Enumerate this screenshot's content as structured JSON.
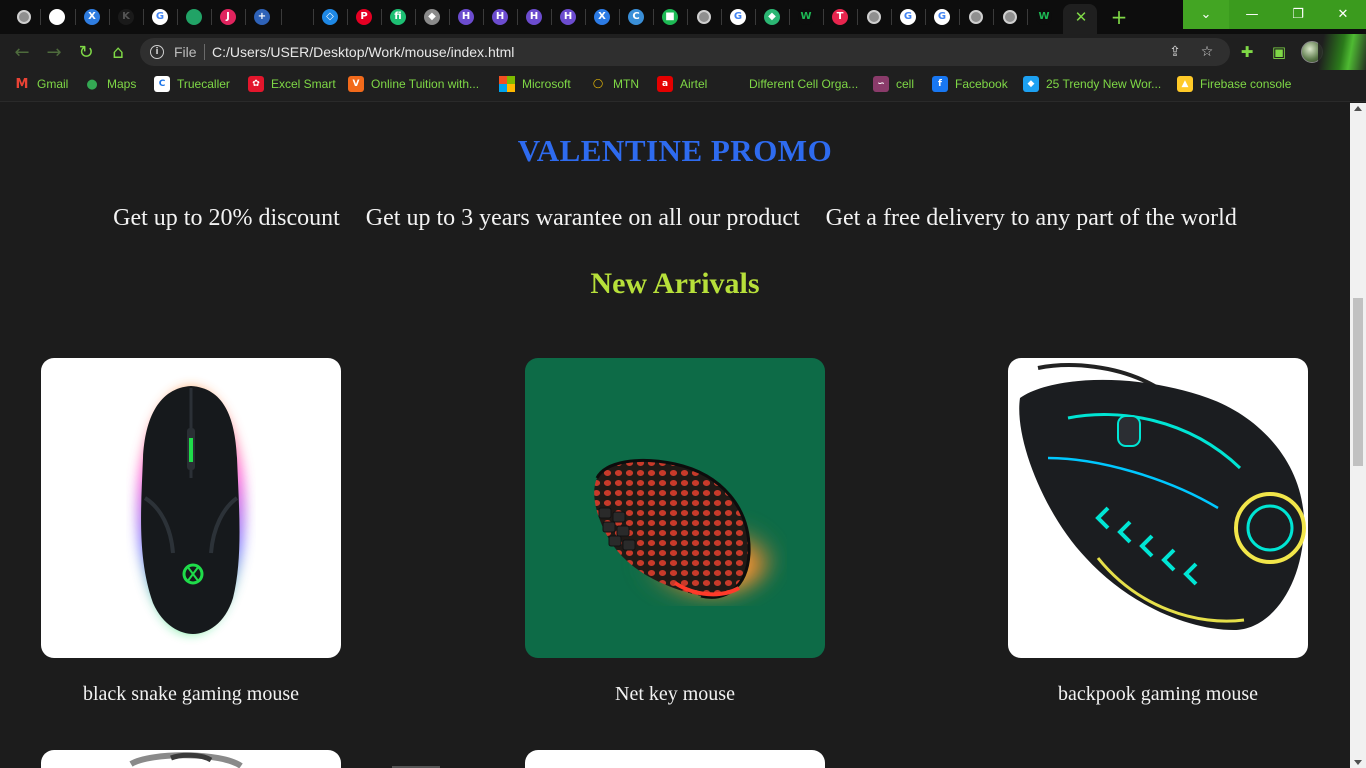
{
  "browser": {
    "tabs": [
      {
        "icon": "globe-icon",
        "color": "#9a9a9a",
        "glyph": ""
      },
      {
        "icon": "github-icon",
        "color": "#ffffff",
        "glyph": ""
      },
      {
        "icon": "x-brand-icon",
        "color": "#2f7de1",
        "glyph": "X"
      },
      {
        "icon": "k-letter-icon",
        "color": "#1a1a1a",
        "glyph": "K"
      },
      {
        "icon": "google-icon",
        "color": "#ffffff",
        "glyph": "G"
      },
      {
        "icon": "sheet-icon",
        "color": "#21a366",
        "glyph": ""
      },
      {
        "icon": "j-letter-icon",
        "color": "#e0245e",
        "glyph": "J"
      },
      {
        "icon": "cross-icon",
        "color": "#2e62b8",
        "glyph": "+"
      },
      {
        "icon": "blank-icon",
        "color": "#0d0d0d",
        "glyph": ""
      },
      {
        "icon": "code-icon",
        "color": "#1e88e5",
        "glyph": "◇"
      },
      {
        "icon": "pinterest-icon",
        "color": "#e60023",
        "glyph": "P"
      },
      {
        "icon": "fiverr-icon",
        "color": "#1dbf73",
        "glyph": "fi"
      },
      {
        "icon": "layers-icon",
        "color": "#8a8a8a",
        "glyph": "◆"
      },
      {
        "icon": "hackerrank-icon",
        "color": "#6c4ccf",
        "glyph": "H"
      },
      {
        "icon": "hackerrank-icon",
        "color": "#6c4ccf",
        "glyph": "H"
      },
      {
        "icon": "hackerrank-icon",
        "color": "#6c4ccf",
        "glyph": "H"
      },
      {
        "icon": "hackerrank-icon",
        "color": "#6c4ccf",
        "glyph": "H"
      },
      {
        "icon": "excel-icon",
        "color": "#2c7be5",
        "glyph": "X"
      },
      {
        "icon": "canva-icon",
        "color": "#3a8fd8",
        "glyph": "C"
      },
      {
        "icon": "green-square-icon",
        "color": "#1db954",
        "glyph": "■"
      },
      {
        "icon": "globe-icon",
        "color": "#9a9a9a",
        "glyph": ""
      },
      {
        "icon": "google-icon",
        "color": "#ffffff",
        "glyph": "G"
      },
      {
        "icon": "tag-icon",
        "color": "#2bb673",
        "glyph": "◆"
      },
      {
        "icon": "w-letter-icon",
        "color": "#0d0d0d",
        "glyph": "W"
      },
      {
        "icon": "cube-icon",
        "color": "#e8254e",
        "glyph": "T"
      },
      {
        "icon": "globe-icon",
        "color": "#9a9a9a",
        "glyph": ""
      },
      {
        "icon": "google-icon",
        "color": "#ffffff",
        "glyph": "G"
      },
      {
        "icon": "google-icon",
        "color": "#ffffff",
        "glyph": "G"
      },
      {
        "icon": "globe-icon",
        "color": "#9a9a9a",
        "glyph": ""
      },
      {
        "icon": "globe-icon",
        "color": "#9a9a9a",
        "glyph": ""
      },
      {
        "icon": "w-letter-icon",
        "color": "#0d0d0d",
        "glyph": "W"
      }
    ],
    "active_tab_close": "✕",
    "new_tab": "+",
    "window_buttons": {
      "dropdown": "⌄",
      "minimize": "—",
      "restore": "❐",
      "close": "✕"
    },
    "address": {
      "scheme_label": "File",
      "url": "C:/Users/USER/Desktop/Work/mouse/index.html"
    },
    "bookmarks": [
      {
        "label": "Gmail",
        "icon": "gmail-icon",
        "color": "#ea4335",
        "glyph": "M"
      },
      {
        "label": "Maps",
        "icon": "maps-icon",
        "color": "#34a853",
        "glyph": "●"
      },
      {
        "label": "Truecaller",
        "icon": "truecaller-icon",
        "color": "#ffffff",
        "glyph": "C"
      },
      {
        "label": "Excel Smart",
        "icon": "huawei-icon",
        "color": "#e3162c",
        "glyph": "✿"
      },
      {
        "label": "Online Tuition with...",
        "icon": "v-letter-icon",
        "color": "#f26a1b",
        "glyph": "V"
      },
      {
        "label": "Microsoft",
        "icon": "microsoft-icon",
        "color": "#f25022",
        "glyph": ""
      },
      {
        "label": "MTN",
        "icon": "mtn-icon",
        "color": "#ffcb05",
        "glyph": "◯"
      },
      {
        "label": "Airtel",
        "icon": "airtel-icon",
        "color": "#e40000",
        "glyph": "a"
      },
      {
        "label": "Different Cell Orga...",
        "icon": "blank-icon",
        "color": "#1f1f1f",
        "glyph": ""
      },
      {
        "label": "cell",
        "icon": "cell-icon",
        "color": "#8a3b6a",
        "glyph": "∽"
      },
      {
        "label": "Facebook",
        "icon": "facebook-icon",
        "color": "#1877f2",
        "glyph": "f"
      },
      {
        "label": "25 Trendy New Wor...",
        "icon": "bird-icon",
        "color": "#1da1f2",
        "glyph": "◆"
      },
      {
        "label": "Firebase console",
        "icon": "firebase-icon",
        "color": "#ffca28",
        "glyph": "▲"
      }
    ]
  },
  "page": {
    "promo_title": "VALENTINE PROMO",
    "promo_items": [
      "Get up to 20% discount",
      "Get up to 3 years warantee on all our product",
      "Get a free delivery to any part of the world"
    ],
    "arrivals_title": "New Arrivals",
    "products": [
      {
        "name": "black snake gaming mouse",
        "image": "black-snake-mouse-image"
      },
      {
        "name": "Net key mouse",
        "image": "net-key-mouse-image"
      },
      {
        "name": "backpook gaming mouse",
        "image": "backpook-mouse-image"
      }
    ]
  },
  "colors": {
    "page_bg": "#1c1c1c",
    "promo_title": "#2e6bef",
    "arrivals_title": "#b7e03a",
    "accent_green": "#7fd846",
    "window_green": "#3b9b1e",
    "card_green": "#0d6b47"
  }
}
